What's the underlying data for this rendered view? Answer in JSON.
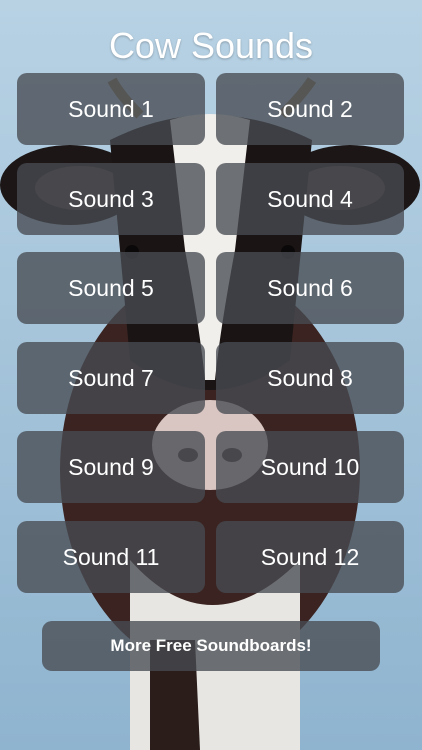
{
  "app": {
    "title": "Cow Sounds"
  },
  "buttons": [
    {
      "label": "Sound 1"
    },
    {
      "label": "Sound 2"
    },
    {
      "label": "Sound 3"
    },
    {
      "label": "Sound 4"
    },
    {
      "label": "Sound 5"
    },
    {
      "label": "Sound 6"
    },
    {
      "label": "Sound 7"
    },
    {
      "label": "Sound 8"
    },
    {
      "label": "Sound 9"
    },
    {
      "label": "Sound 10"
    },
    {
      "label": "Sound 11"
    },
    {
      "label": "Sound 12"
    }
  ],
  "footer": {
    "more_label": "More Free Soundboards!"
  },
  "colors": {
    "sky": "#a9c6da",
    "button_bg": "#484c52",
    "text": "#ffffff"
  }
}
